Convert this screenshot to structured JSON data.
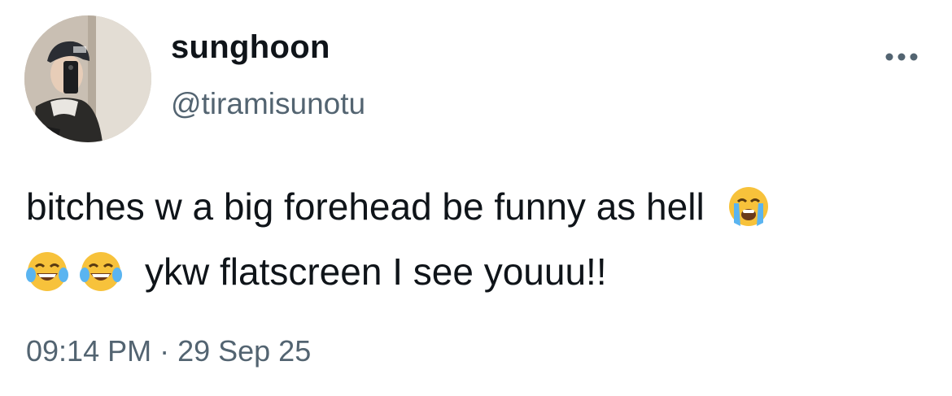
{
  "user": {
    "display_name": "sunghoon",
    "handle": "@tiramisunotu",
    "avatar_icon": "profile-photo"
  },
  "menu": {
    "icon": "more-horizontal-icon"
  },
  "tweet": {
    "line1_text": "bitches w a big forehead be funny as hell",
    "line1_emoji": "loudly-crying-face-emoji",
    "line2_emojis": [
      "face-with-tears-of-joy-emoji",
      "face-with-tears-of-joy-emoji"
    ],
    "line2_text": "ykw flatscreen I see youuu!!"
  },
  "meta": {
    "timestamp": "09:14 PM · 29 Sep 25"
  },
  "colors": {
    "text_primary": "#0f1419",
    "text_secondary": "#536471",
    "background": "#ffffff"
  }
}
